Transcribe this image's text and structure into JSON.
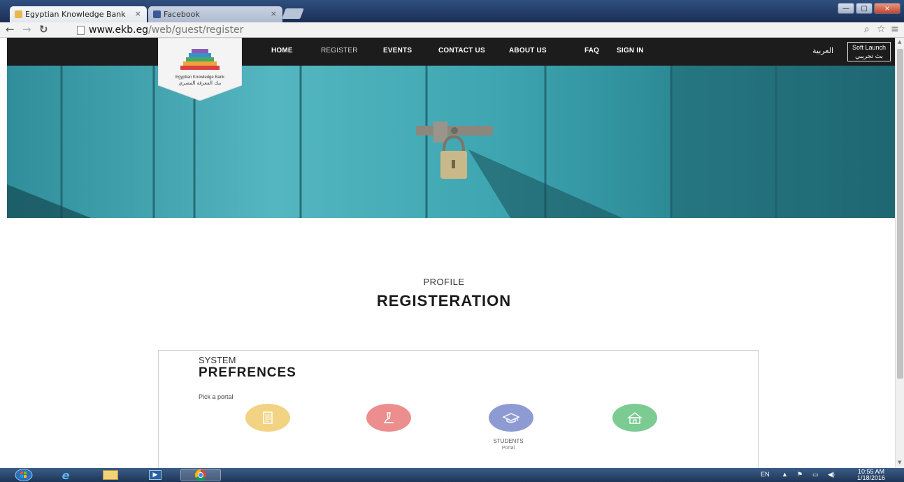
{
  "browser": {
    "tabs": [
      {
        "label": "Egyptian Knowledge Bank",
        "close": "×",
        "active": true
      },
      {
        "label": "Facebook",
        "close": "×",
        "active": false
      }
    ],
    "window_controls": {
      "minimize": "—",
      "maximize": "□",
      "close": "×"
    },
    "url_host": "www.ekb.eg",
    "url_path": "/web/guest/register"
  },
  "site": {
    "logo_en": "Egyptian Knowledge Bank",
    "logo_ar": "بنك المعرفة المصري",
    "nav": [
      "HOME",
      "REGISTER",
      "EVENTS",
      "CONTACT US",
      "ABOUT US",
      "FAQ",
      "SIGN IN"
    ],
    "lang_toggle": "العربية",
    "soft_launch_en": "Soft Launch",
    "soft_launch_ar": "بث تجريبي"
  },
  "main": {
    "subheading": "PROFILE",
    "heading": "REGISTERATION"
  },
  "preferences": {
    "subheading": "SYSTEM",
    "heading": "PREFRENCES",
    "prompt": "Pick a portal",
    "portals": [
      {
        "icon": "document-icon",
        "color": "#f2d384"
      },
      {
        "icon": "microscope-icon",
        "color": "#ec8e8e"
      },
      {
        "icon": "graduation-cap-icon",
        "color": "#8e9bd2",
        "label": "STUDENTS",
        "sublabel": "Portal"
      },
      {
        "icon": "school-building-icon",
        "color": "#7ccb93"
      }
    ]
  },
  "taskbar": {
    "language": "EN",
    "time": "10:55 AM",
    "date": "1/18/2016"
  },
  "colors": {
    "nav_bg": "#1c1c1c",
    "door_teal": "#3aa3af"
  }
}
